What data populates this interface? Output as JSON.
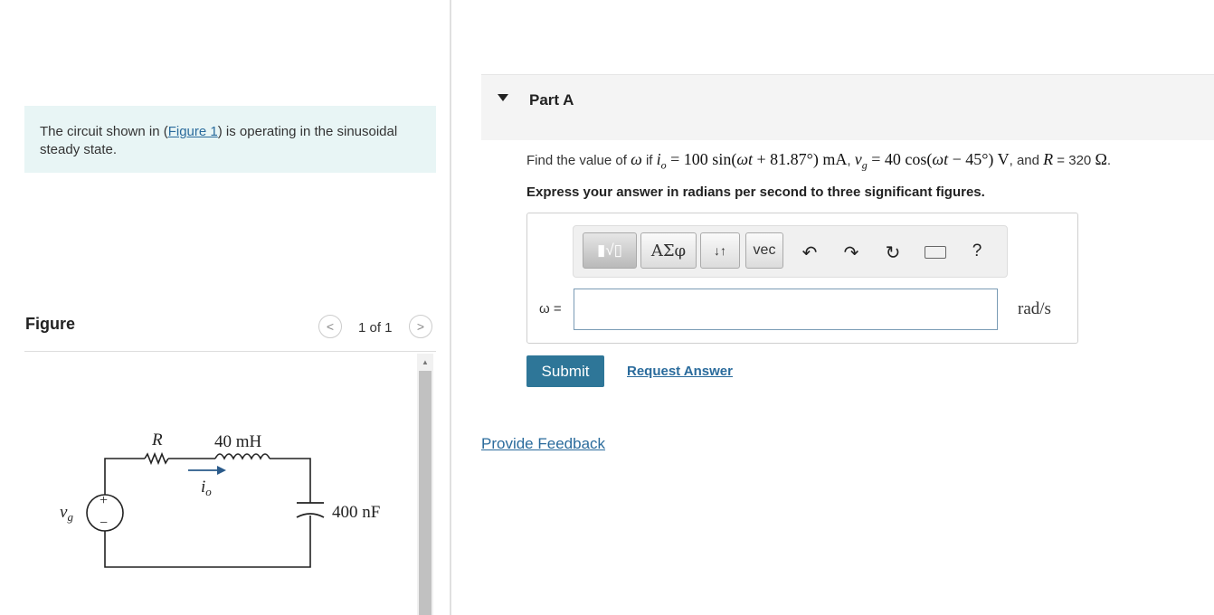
{
  "problem": {
    "intro_prefix": "The circuit shown in (",
    "intro_link": "Figure 1",
    "intro_suffix": ") is operating in the sinusoidal steady state."
  },
  "figure_panel": {
    "title": "Figure",
    "page_counter": "1 of 1",
    "prev_symbol": "<",
    "next_symbol": ">"
  },
  "circuit": {
    "resistor_label": "R",
    "inductor_label": "40 mH",
    "current_label": "i",
    "current_subscript": "o",
    "capacitor_label": "400 nF",
    "source_label": "v",
    "source_subscript": "g",
    "plus": "+",
    "minus": "−"
  },
  "part": {
    "caret": "▼",
    "title": "Part A",
    "q_prefix": "Find the value of ",
    "q_omega": "ω",
    "q_if": " if ",
    "q_io_expr": "i_o = 100 sin(ωt + 81.87°) mA",
    "q_sep1": ", ",
    "q_vg_expr": "v_g = 40 cos(ωt − 45°) V",
    "q_and": ", and ",
    "q_R": "R",
    "q_R_value": " = 320 ",
    "q_ohm": "Ω",
    "q_end": ".",
    "instruction": "Express your answer in radians per second to three significant figures."
  },
  "toolbar": {
    "templates_icon": "templates-icon",
    "templates_glyph": "▮√▯",
    "greek_label": "ΑΣφ",
    "arrows_label": "↓↑",
    "vec_label": "vec",
    "undo_glyph": "↶",
    "redo_glyph": "↷",
    "reset_glyph": "↻",
    "keyboard_icon": "keyboard-icon",
    "help_glyph": "?"
  },
  "answer": {
    "label": "ω =",
    "value": "",
    "unit": "rad/s"
  },
  "actions": {
    "submit": "Submit",
    "request_answer": "Request Answer",
    "feedback": "Provide Feedback"
  },
  "colors": {
    "intro_bg": "#e8f5f5",
    "submit_bg": "#2e7698",
    "link": "#2a6b9c"
  }
}
